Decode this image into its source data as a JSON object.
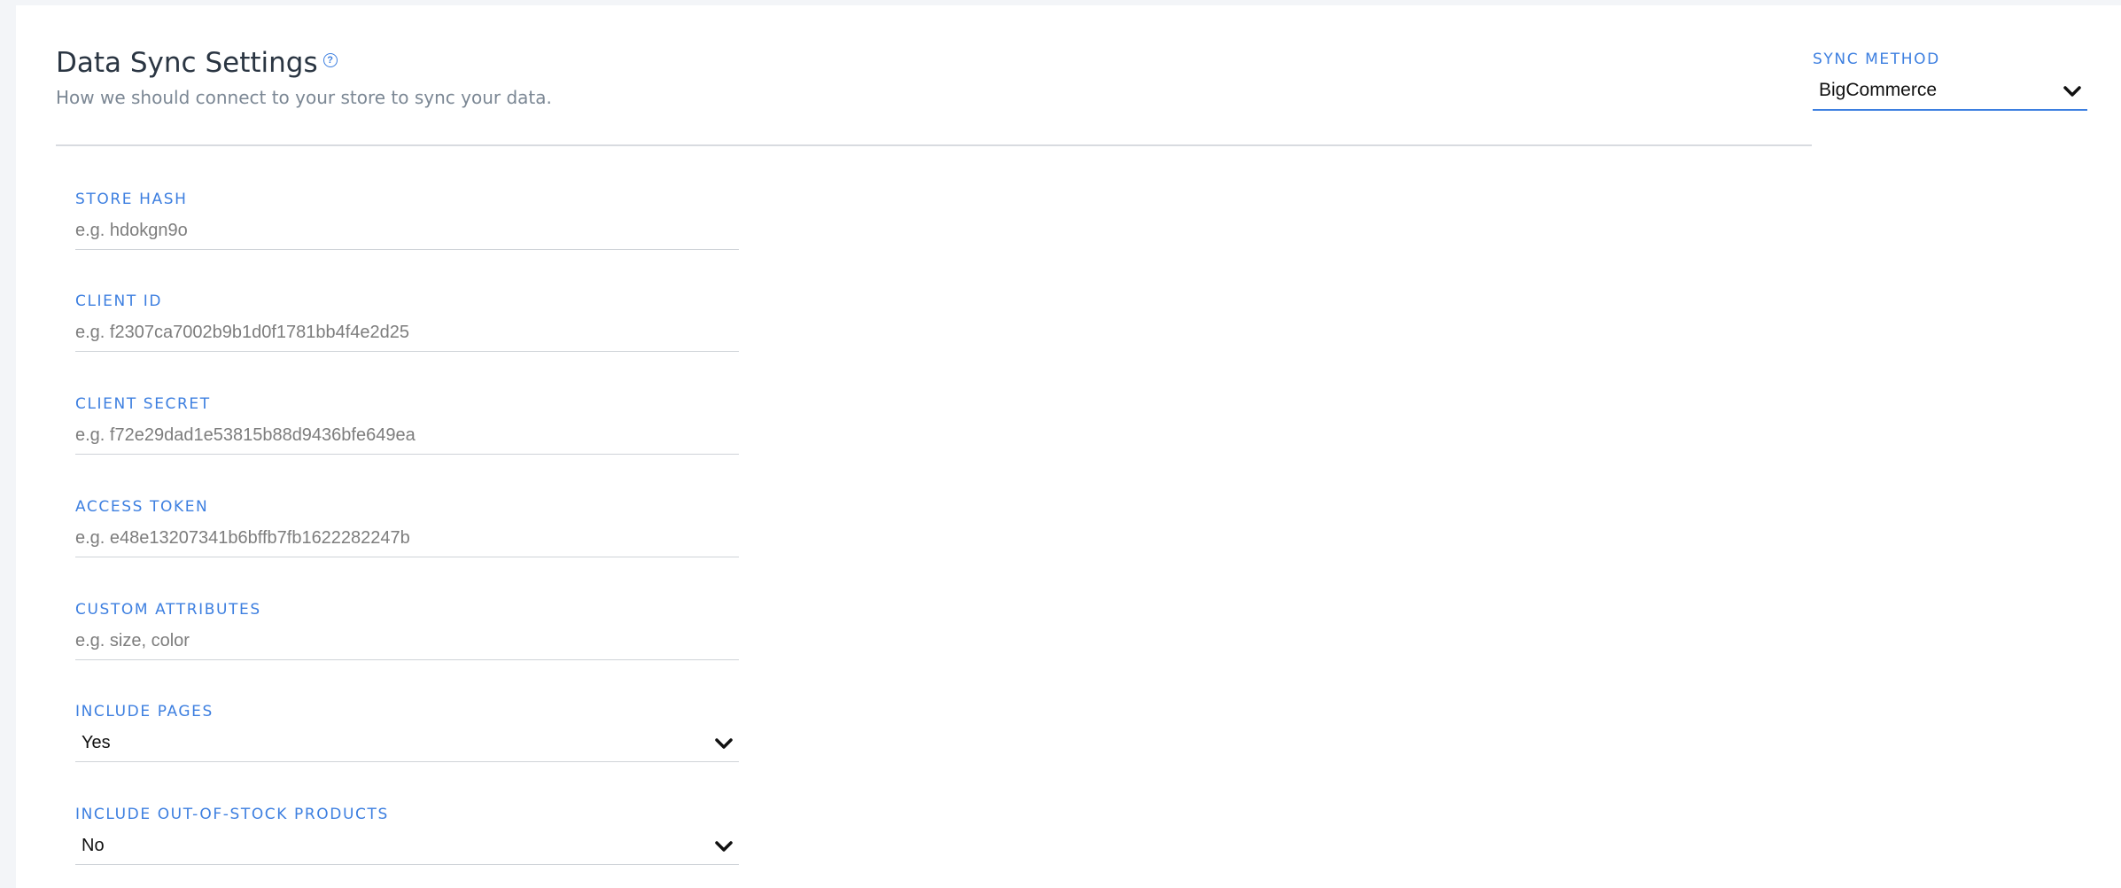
{
  "header": {
    "title": "Data Sync Settings",
    "help_glyph": "?",
    "subtitle": "How we should connect to your store to sync your data."
  },
  "sync_method": {
    "label": "SYNC METHOD",
    "value": "BigCommerce"
  },
  "fields": {
    "store_hash": {
      "label": "STORE HASH",
      "placeholder": "e.g. hdokgn9o",
      "value": ""
    },
    "client_id": {
      "label": "CLIENT ID",
      "placeholder": "e.g. f2307ca7002b9b1d0f1781bb4f4e2d25",
      "value": ""
    },
    "client_secret": {
      "label": "CLIENT SECRET",
      "placeholder": "e.g. f72e29dad1e53815b88d9436bfe649ea",
      "value": ""
    },
    "access_token": {
      "label": "ACCESS TOKEN",
      "placeholder": "e.g. e48e13207341b6bffb7fb1622282247b",
      "value": ""
    },
    "custom_attributes": {
      "label": "CUSTOM ATTRIBUTES",
      "placeholder": "e.g. size, color",
      "value": ""
    }
  },
  "selects": {
    "include_pages": {
      "label": "INCLUDE PAGES",
      "value": "Yes"
    },
    "include_oos": {
      "label": "INCLUDE OUT-OF-STOCK PRODUCTS",
      "value": "No"
    }
  },
  "icons": {
    "help": "help-circle-icon",
    "dropdown": "chevron-down-icon"
  },
  "colors": {
    "accent": "#3d7fe0",
    "title": "#2a3542",
    "subtitle": "#7b8794",
    "placeholder": "#7d7d7d",
    "divider": "#d8dbe0"
  }
}
